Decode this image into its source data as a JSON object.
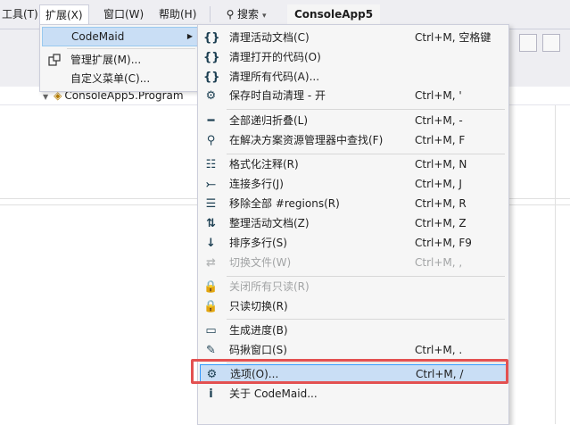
{
  "menubar": {
    "items": [
      {
        "label": "工具(T)"
      },
      {
        "label": "扩展(X)"
      },
      {
        "label": "窗口(W)"
      },
      {
        "label": "帮助(H)"
      }
    ],
    "search_label": "搜索",
    "search_glyph": "⚲",
    "app_title": "ConsoleApp5"
  },
  "editor": {
    "nav_dropdown": "ConsoleApp5.Program"
  },
  "extensions_menu": {
    "items": [
      {
        "label": "CodeMaid",
        "icon": "none",
        "has_submenu": true
      },
      {
        "label": "管理扩展(M)...",
        "icon": "extensions-icon"
      },
      {
        "label": "自定义菜单(C)...",
        "icon": "none"
      }
    ]
  },
  "codemaid_menu": {
    "items": [
      {
        "label": "清理活动文档(C)",
        "shortcut": "Ctrl+M, 空格键",
        "icon": "{}"
      },
      {
        "label": "清理打开的代码(O)",
        "shortcut": "",
        "icon": "{}"
      },
      {
        "label": "清理所有代码(A)...",
        "shortcut": "",
        "icon": "{}"
      },
      {
        "label": "保存时自动清理 - 开",
        "shortcut": "Ctrl+M, '",
        "icon": "⚙"
      },
      {
        "label": "全部递归折叠(L)",
        "shortcut": "Ctrl+M, -",
        "icon": "━"
      },
      {
        "label": "在解决方案资源管理器中查找(F)",
        "shortcut": "Ctrl+M, F",
        "icon": "⚲"
      },
      {
        "label": "格式化注释(R)",
        "shortcut": "Ctrl+M, N",
        "icon": "☷"
      },
      {
        "label": "连接多行(J)",
        "shortcut": "Ctrl+M, J",
        "icon": "⤚"
      },
      {
        "label": "移除全部 #regions(R)",
        "shortcut": "Ctrl+M, R",
        "icon": "☰"
      },
      {
        "label": "整理活动文档(Z)",
        "shortcut": "Ctrl+M, Z",
        "icon": "⇅"
      },
      {
        "label": "排序多行(S)",
        "shortcut": "Ctrl+M, F9",
        "icon": "↓"
      },
      {
        "label": "切换文件(W)",
        "shortcut": "Ctrl+M, ,",
        "icon": "⇄"
      },
      {
        "label": "关闭所有只读(R)",
        "shortcut": "",
        "icon": "🔒"
      },
      {
        "label": "只读切换(R)",
        "shortcut": "",
        "icon": "🔒"
      },
      {
        "label": "生成进度(B)",
        "shortcut": "",
        "icon": "▭"
      },
      {
        "label": "码揪窗口(S)",
        "shortcut": "Ctrl+M, .",
        "icon": "✎"
      },
      {
        "label": "选项(O)...",
        "shortcut": "Ctrl+M, /",
        "icon": "⚙"
      },
      {
        "label": "关于 CodeMaid...",
        "shortcut": "",
        "icon": "i"
      }
    ]
  },
  "colors": {
    "highlight": "#c9def5",
    "highlight_border": "#3399ff",
    "annotation_red": "#e35151",
    "disabled_text": "#a2a4a5"
  }
}
